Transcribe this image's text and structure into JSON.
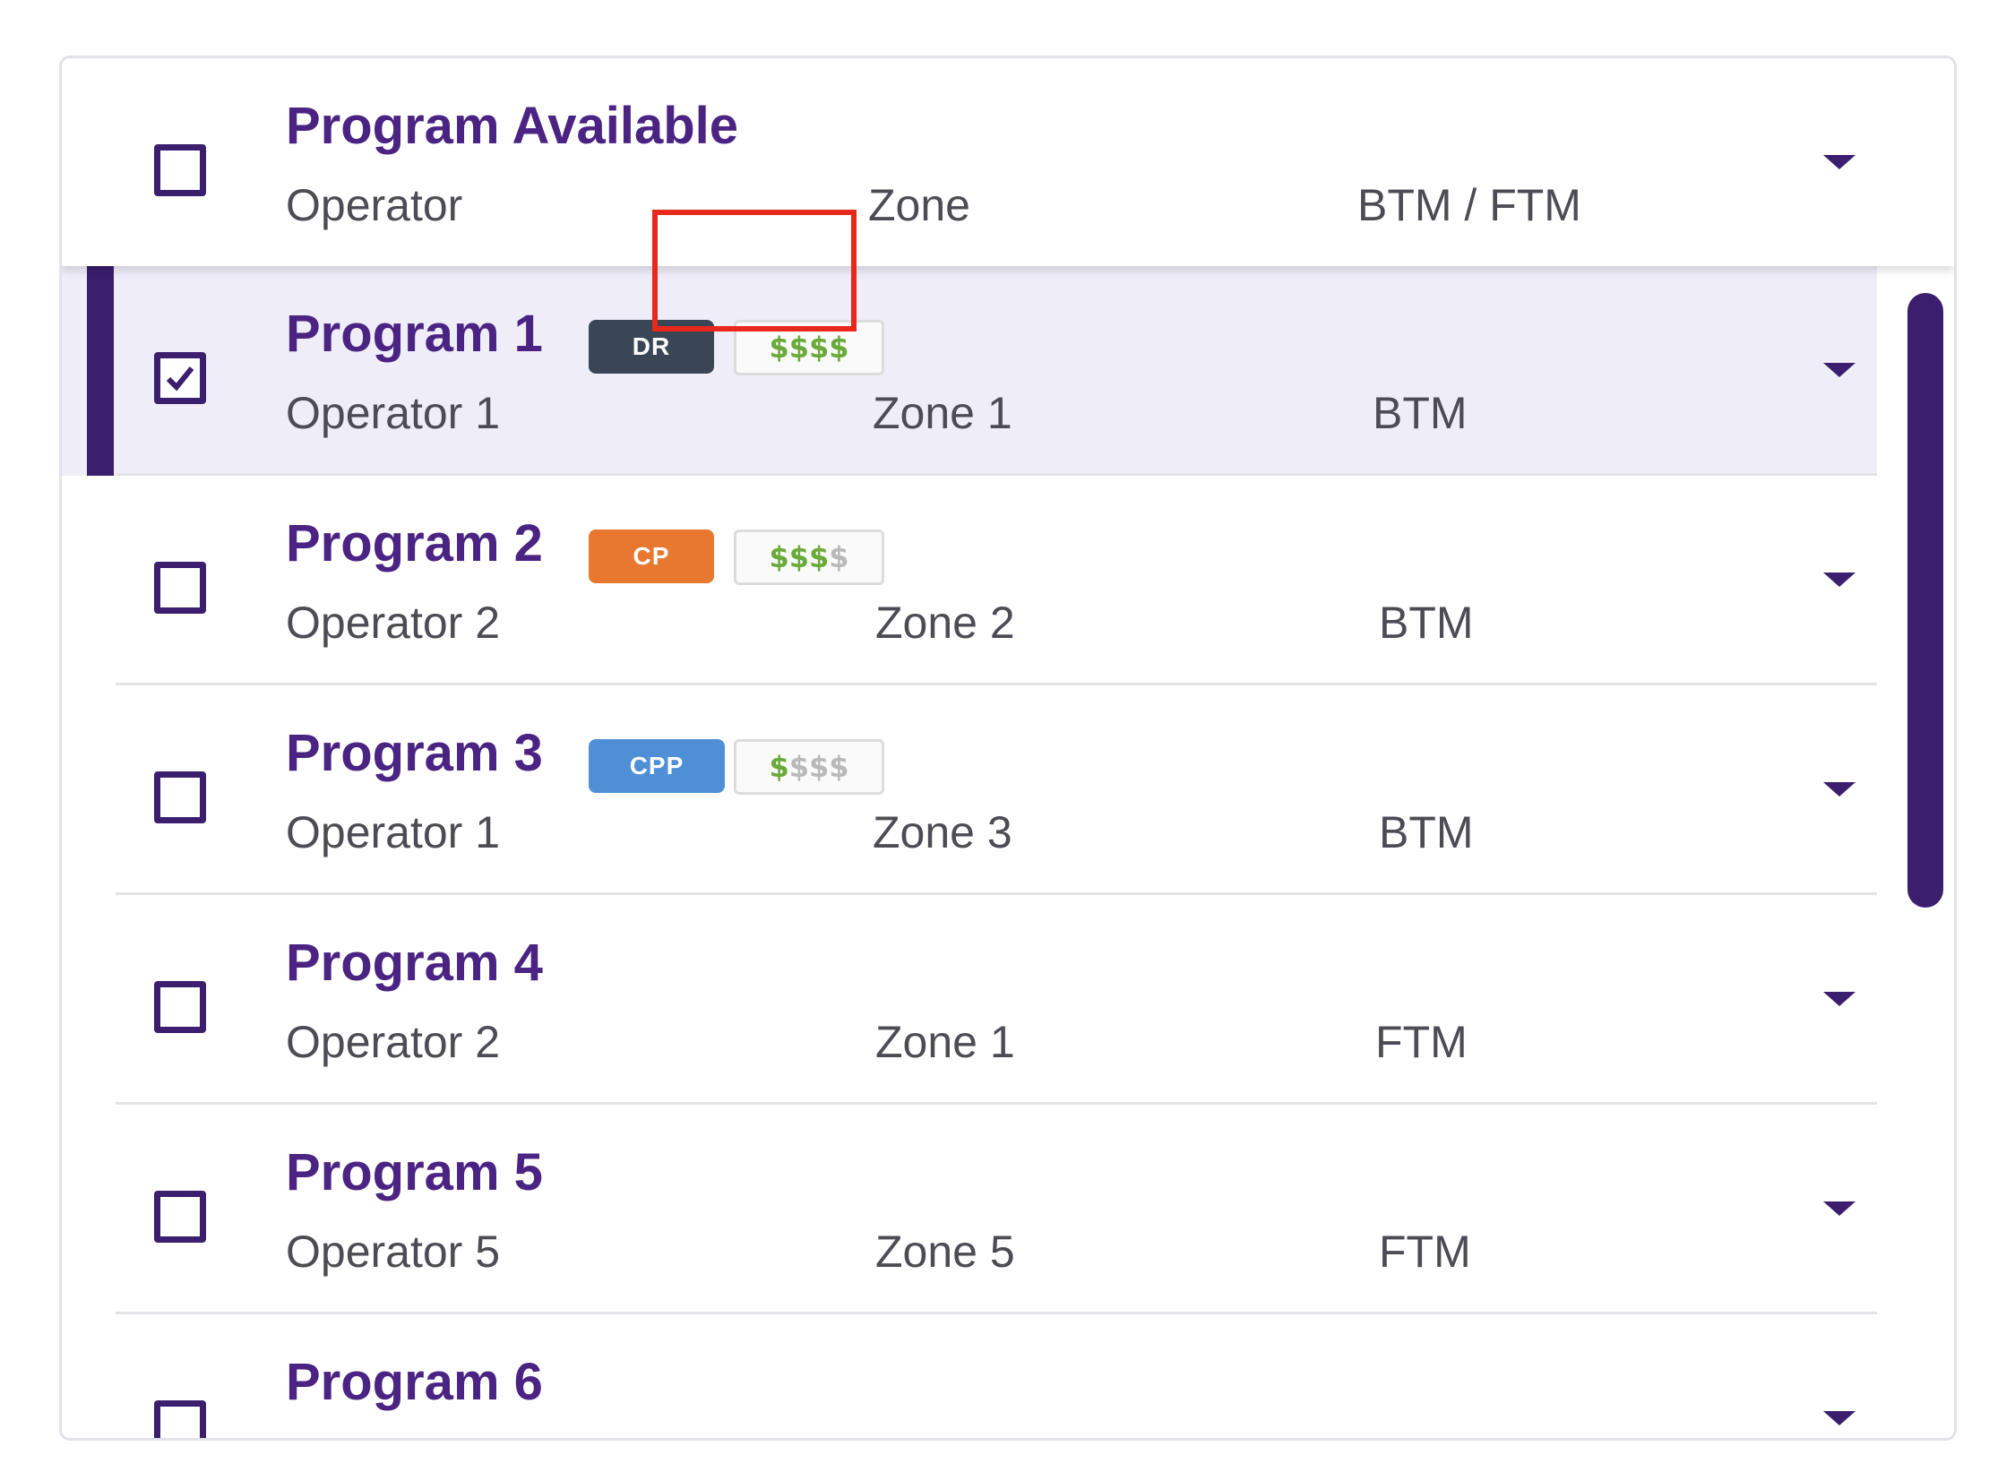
{
  "header": {
    "title": "Program Available",
    "col_operator": "Operator",
    "col_zone": "Zone",
    "col_btm_ftm": "BTM / FTM"
  },
  "programs": [
    {
      "name": "Program 1",
      "operator": "Operator 1",
      "zone": "Zone 1",
      "type": "BTM",
      "badge": "DR",
      "price": "$$$$",
      "price_level": 4,
      "checked": true
    },
    {
      "name": "Program 2",
      "operator": "Operator 2",
      "zone": "Zone 2",
      "type": "BTM",
      "badge": "CP",
      "price": "$$$$",
      "price_level": 3,
      "checked": false
    },
    {
      "name": "Program 3",
      "operator": "Operator 1",
      "zone": "Zone 3",
      "type": "BTM",
      "badge": "CPP",
      "price": "$$$$",
      "price_level": 1,
      "checked": false
    },
    {
      "name": "Program 4",
      "operator": "Operator 2",
      "zone": "Zone 1",
      "type": "FTM",
      "checked": false
    },
    {
      "name": "Program 5",
      "operator": "Operator 5",
      "zone": "Zone 5",
      "type": "FTM",
      "checked": false
    },
    {
      "name": "Program 6",
      "checked": false
    }
  ],
  "colors": {
    "accent": "#3b1e6e",
    "title": "#4b2483",
    "badge_dr": "#3a4555",
    "badge_cp": "#e8782f",
    "badge_cpp": "#4f8fd6",
    "price_active": "#6aaa3a",
    "price_inactive": "#b9b9b9",
    "selected_row_bg": "#efedf8",
    "highlight_border": "#e8281a"
  }
}
